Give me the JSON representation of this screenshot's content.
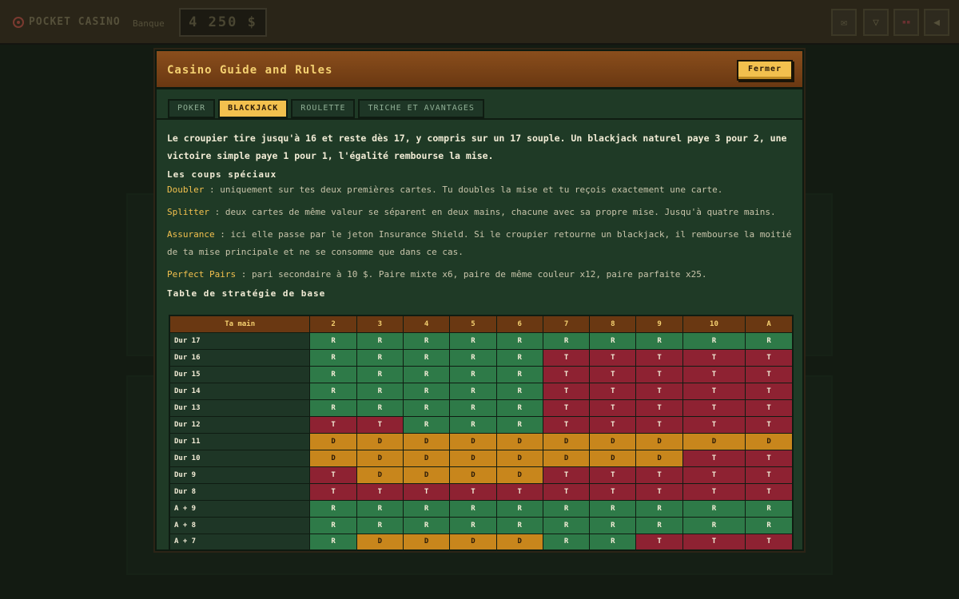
{
  "topbar": {
    "brand": "POCKET CASINO",
    "bank_label": "Banque",
    "bank_value": "4 250 $",
    "icons": [
      "mail-icon",
      "cocktail-icon",
      "flag-icon",
      "speaker-icon"
    ]
  },
  "modal": {
    "title": "Casino Guide and Rules",
    "close_label": "Fermer",
    "tabs": [
      "POKER",
      "BLACKJACK",
      "ROULETTE",
      "TRICHE ET AVANTAGES"
    ],
    "active_tab": "BLACKJACK",
    "intro": "Le croupier tire jusqu'à 16 et reste dès 17, y compris sur un 17 souple. Un blackjack naturel paye 3 pour 2, une victoire simple paye 1 pour 1, l'égalité rembourse la mise.",
    "special_title": "Les coups spéciaux",
    "rules": [
      {
        "term": "Doubler",
        "text": " : uniquement sur tes deux premières cartes. Tu doubles la mise et tu reçois exactement une carte."
      },
      {
        "term": "Splitter",
        "text": " : deux cartes de même valeur se séparent en deux mains, chacune avec sa propre mise. Jusqu'à quatre mains."
      },
      {
        "term": "Assurance",
        "text": " : ici elle passe par le jeton Insurance Shield. Si le croupier retourne un blackjack, il rembourse la moitié de ta mise principale et ne se consomme que dans ce cas."
      },
      {
        "term": "Perfect Pairs",
        "text": " : pari secondaire à 10 $. Paire mixte x6, paire de même couleur x12, paire parfaite x25."
      }
    ],
    "strategy_title": "Table de stratégie de base",
    "strategy_table": {
      "header": [
        "Ta main",
        "2",
        "3",
        "4",
        "5",
        "6",
        "7",
        "8",
        "9",
        "10",
        "A"
      ],
      "rows": [
        {
          "hand": "Dur 17",
          "cells": [
            "R",
            "R",
            "R",
            "R",
            "R",
            "R",
            "R",
            "R",
            "R",
            "R"
          ]
        },
        {
          "hand": "Dur 16",
          "cells": [
            "R",
            "R",
            "R",
            "R",
            "R",
            "T",
            "T",
            "T",
            "T",
            "T"
          ]
        },
        {
          "hand": "Dur 15",
          "cells": [
            "R",
            "R",
            "R",
            "R",
            "R",
            "T",
            "T",
            "T",
            "T",
            "T"
          ]
        },
        {
          "hand": "Dur 14",
          "cells": [
            "R",
            "R",
            "R",
            "R",
            "R",
            "T",
            "T",
            "T",
            "T",
            "T"
          ]
        },
        {
          "hand": "Dur 13",
          "cells": [
            "R",
            "R",
            "R",
            "R",
            "R",
            "T",
            "T",
            "T",
            "T",
            "T"
          ]
        },
        {
          "hand": "Dur 12",
          "cells": [
            "T",
            "T",
            "R",
            "R",
            "R",
            "T",
            "T",
            "T",
            "T",
            "T"
          ]
        },
        {
          "hand": "Dur 11",
          "cells": [
            "D",
            "D",
            "D",
            "D",
            "D",
            "D",
            "D",
            "D",
            "D",
            "D"
          ]
        },
        {
          "hand": "Dur 10",
          "cells": [
            "D",
            "D",
            "D",
            "D",
            "D",
            "D",
            "D",
            "D",
            "T",
            "T"
          ]
        },
        {
          "hand": "Dur 9",
          "cells": [
            "T",
            "D",
            "D",
            "D",
            "D",
            "T",
            "T",
            "T",
            "T",
            "T"
          ]
        },
        {
          "hand": "Dur 8",
          "cells": [
            "T",
            "T",
            "T",
            "T",
            "T",
            "T",
            "T",
            "T",
            "T",
            "T"
          ]
        },
        {
          "hand": "A + 9",
          "cells": [
            "R",
            "R",
            "R",
            "R",
            "R",
            "R",
            "R",
            "R",
            "R",
            "R"
          ]
        },
        {
          "hand": "A + 8",
          "cells": [
            "R",
            "R",
            "R",
            "R",
            "R",
            "R",
            "R",
            "R",
            "R",
            "R"
          ]
        },
        {
          "hand": "A + 7",
          "cells": [
            "R",
            "D",
            "D",
            "D",
            "D",
            "R",
            "R",
            "T",
            "T",
            "T"
          ]
        }
      ]
    }
  },
  "colors": {
    "accent": "#f2c04e",
    "stand": "#2e7a48",
    "hit": "#8e2232",
    "double": "#c8861c",
    "header_brown": "#6a3812"
  }
}
